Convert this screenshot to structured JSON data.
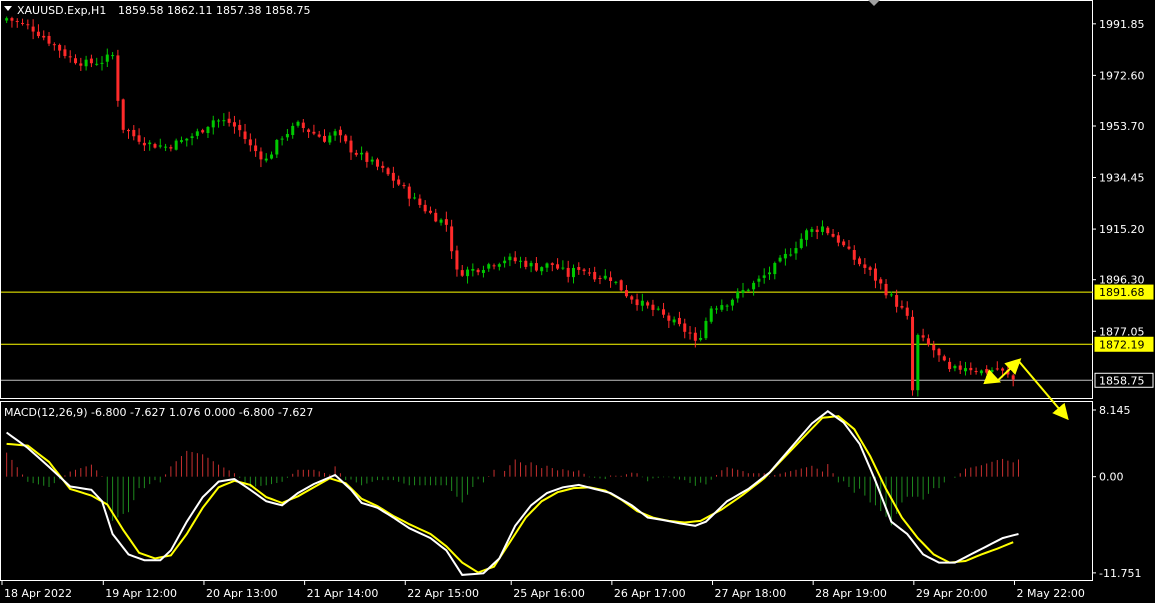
{
  "header": {
    "symbol": "XAUUSD.Exp,H1",
    "ohlc": "1859.58 1862.11 1857.38 1858.75"
  },
  "macd_header": {
    "label": "MACD(12,26,9) -6.800 -7.627 1.076 0.000 -6.800 -7.627"
  },
  "colors": {
    "background": "#000000",
    "bull": "#00c800",
    "bear": "#ff2a2a",
    "grid_frame": "#ffffff",
    "hline": "#ffff00",
    "macd_line": "#ffffff",
    "signal_line": "#ffff00",
    "arrow": "#ffff00"
  },
  "chart_data": [
    {
      "type": "candlestick",
      "symbol": "XAUUSD.Exp",
      "timeframe": "H1",
      "ylim": [
        1852.5,
        2000
      ],
      "y_ticks": [
        "1991.85",
        "1972.60",
        "1953.70",
        "1934.45",
        "1915.20",
        "1896.30",
        "1877.05"
      ],
      "x_ticks": [
        "18 Apr 2022",
        "19 Apr 12:00",
        "20 Apr 13:00",
        "21 Apr 14:00",
        "22 Apr 15:00",
        "25 Apr 16:00",
        "26 Apr 17:00",
        "27 Apr 18:00",
        "28 Apr 19:00",
        "29 Apr 20:00",
        "2 May 22:00"
      ],
      "horizontal_levels": [
        {
          "value": 1891.68,
          "label": "1891.68",
          "style": "tag-yellow"
        },
        {
          "value": 1872.19,
          "label": "1872.19",
          "style": "tag-yellow"
        },
        {
          "value": 1858.75,
          "label": "1858.75",
          "style": "tag-current"
        }
      ],
      "close_path": [
        [
          0,
          1994
        ],
        [
          5,
          1990
        ],
        [
          9,
          1984
        ],
        [
          12,
          1979
        ],
        [
          15,
          1977
        ],
        [
          18,
          1978
        ],
        [
          20,
          1980
        ],
        [
          21,
          1964
        ],
        [
          22,
          1953
        ],
        [
          24,
          1950
        ],
        [
          27,
          1947
        ],
        [
          30,
          1946
        ],
        [
          33,
          1948
        ],
        [
          36,
          1951
        ],
        [
          39,
          1956
        ],
        [
          42,
          1955
        ],
        [
          44,
          1952
        ],
        [
          46,
          1946
        ],
        [
          49,
          1941
        ],
        [
          52,
          1950
        ],
        [
          55,
          1954
        ],
        [
          57,
          1952
        ],
        [
          60,
          1949
        ],
        [
          62,
          1951
        ],
        [
          65,
          1945
        ],
        [
          68,
          1941
        ],
        [
          71,
          1937
        ],
        [
          74,
          1932
        ],
        [
          77,
          1926
        ],
        [
          80,
          1921
        ],
        [
          83,
          1917
        ],
        [
          85,
          1899
        ],
        [
          88,
          1900
        ],
        [
          91,
          1902
        ],
        [
          94,
          1904
        ],
        [
          97,
          1903
        ],
        [
          100,
          1901
        ],
        [
          103,
          1902
        ],
        [
          106,
          1898
        ],
        [
          108,
          1901
        ],
        [
          111,
          1898
        ],
        [
          114,
          1897
        ],
        [
          117,
          1891
        ],
        [
          120,
          1887
        ],
        [
          123,
          1884
        ],
        [
          126,
          1880
        ],
        [
          129,
          1876
        ],
        [
          131,
          1876
        ],
        [
          133,
          1886
        ],
        [
          136,
          1888
        ],
        [
          139,
          1892
        ],
        [
          142,
          1896
        ],
        [
          145,
          1901
        ],
        [
          148,
          1907
        ],
        [
          151,
          1914
        ],
        [
          154,
          1916
        ],
        [
          157,
          1911
        ],
        [
          160,
          1904
        ],
        [
          163,
          1899
        ],
        [
          166,
          1892
        ],
        [
          169,
          1885
        ],
        [
          172,
          1875
        ],
        [
          175,
          1870
        ],
        [
          178,
          1862
        ],
        [
          181,
          1864
        ],
        [
          184,
          1862
        ],
        [
          187,
          1863
        ],
        [
          190,
          1859
        ]
      ],
      "highlight_candles": [
        {
          "index": 130,
          "close": 1873.5,
          "low": 1871.0
        },
        {
          "index": 171,
          "close": 1855.0,
          "low": 1853.0
        }
      ],
      "annotations": [
        {
          "type": "arrow",
          "from": [
            185,
            1860
          ],
          "to": [
            187,
            1858.5
          ]
        },
        {
          "type": "arrow",
          "from": [
            187,
            1858.5
          ],
          "to": [
            191,
            1866
          ]
        },
        {
          "type": "arrow",
          "from": [
            191,
            1866
          ],
          "to": [
            200,
            1845
          ]
        }
      ]
    },
    {
      "type": "macd",
      "params": "MACD(12,26,9)",
      "values": {
        "main": -6.8,
        "signal": -7.627,
        "histogram": 1.076,
        "zero": 0.0
      },
      "ylim": [
        -12.5,
        9.0
      ],
      "y_ticks": [
        "8.145",
        "0.00",
        "-11.751"
      ],
      "macd_points": [
        [
          0,
          5.4
        ],
        [
          4,
          3.5
        ],
        [
          8,
          1.2
        ],
        [
          12,
          -1.2
        ],
        [
          16,
          -1.6
        ],
        [
          18,
          -3.0
        ],
        [
          20,
          -7.0
        ],
        [
          23,
          -9.5
        ],
        [
          26,
          -10.2
        ],
        [
          29,
          -10.2
        ],
        [
          31,
          -9.0
        ],
        [
          34,
          -5.5
        ],
        [
          37,
          -2.5
        ],
        [
          40,
          -0.6
        ],
        [
          43,
          -0.3
        ],
        [
          46,
          -1.6
        ],
        [
          49,
          -3.0
        ],
        [
          52,
          -3.5
        ],
        [
          55,
          -2.0
        ],
        [
          58,
          -0.9
        ],
        [
          62,
          0.2
        ],
        [
          65,
          -1.6
        ],
        [
          67,
          -3.2
        ],
        [
          70,
          -3.8
        ],
        [
          73,
          -5.0
        ],
        [
          76,
          -6.3
        ],
        [
          80,
          -7.5
        ],
        [
          83,
          -9.0
        ],
        [
          86,
          -12.0
        ],
        [
          90,
          -11.8
        ],
        [
          93,
          -10.0
        ],
        [
          96,
          -6.0
        ],
        [
          99,
          -3.5
        ],
        [
          102,
          -2.0
        ],
        [
          105,
          -1.3
        ],
        [
          108,
          -1.0
        ],
        [
          111,
          -1.5
        ],
        [
          114,
          -2.0
        ],
        [
          118,
          -3.5
        ],
        [
          121,
          -5.0
        ],
        [
          124,
          -5.3
        ],
        [
          127,
          -5.7
        ],
        [
          130,
          -6.0
        ],
        [
          132,
          -5.5
        ],
        [
          136,
          -3.0
        ],
        [
          140,
          -1.5
        ],
        [
          144,
          0.5
        ],
        [
          148,
          3.5
        ],
        [
          152,
          6.5
        ],
        [
          155,
          8.0
        ],
        [
          158,
          6.6
        ],
        [
          161,
          4.0
        ],
        [
          164,
          -0.5
        ],
        [
          167,
          -5.5
        ],
        [
          170,
          -7.0
        ],
        [
          173,
          -9.5
        ],
        [
          176,
          -10.5
        ],
        [
          179,
          -10.5
        ],
        [
          182,
          -9.5
        ],
        [
          185,
          -8.5
        ],
        [
          188,
          -7.5
        ],
        [
          191,
          -7.0
        ]
      ],
      "signal_points": [
        [
          0,
          4.0
        ],
        [
          4,
          3.8
        ],
        [
          8,
          1.8
        ],
        [
          12,
          -1.5
        ],
        [
          16,
          -2.3
        ],
        [
          19,
          -3.4
        ],
        [
          22,
          -6.5
        ],
        [
          25,
          -9.3
        ],
        [
          28,
          -10.0
        ],
        [
          31,
          -9.6
        ],
        [
          34,
          -7.0
        ],
        [
          37,
          -3.8
        ],
        [
          40,
          -1.3
        ],
        [
          43,
          -0.5
        ],
        [
          46,
          -1.0
        ],
        [
          49,
          -2.5
        ],
        [
          52,
          -3.2
        ],
        [
          55,
          -2.4
        ],
        [
          58,
          -1.3
        ],
        [
          61,
          -0.2
        ],
        [
          64,
          -0.8
        ],
        [
          67,
          -2.7
        ],
        [
          70,
          -3.6
        ],
        [
          73,
          -4.8
        ],
        [
          76,
          -5.8
        ],
        [
          80,
          -7.0
        ],
        [
          83,
          -8.5
        ],
        [
          86,
          -10.5
        ],
        [
          89,
          -11.7
        ],
        [
          92,
          -11.0
        ],
        [
          95,
          -8.0
        ],
        [
          98,
          -5.0
        ],
        [
          101,
          -3.0
        ],
        [
          104,
          -1.9
        ],
        [
          107,
          -1.4
        ],
        [
          110,
          -1.3
        ],
        [
          113,
          -1.7
        ],
        [
          116,
          -2.8
        ],
        [
          119,
          -4.2
        ],
        [
          122,
          -5.0
        ],
        [
          125,
          -5.4
        ],
        [
          128,
          -5.6
        ],
        [
          131,
          -5.4
        ],
        [
          135,
          -4.0
        ],
        [
          139,
          -2.2
        ],
        [
          143,
          -0.2
        ],
        [
          147,
          2.5
        ],
        [
          151,
          5.2
        ],
        [
          154,
          7.2
        ],
        [
          157,
          7.4
        ],
        [
          160,
          5.8
        ],
        [
          163,
          2.5
        ],
        [
          166,
          -1.5
        ],
        [
          169,
          -5.0
        ],
        [
          172,
          -7.5
        ],
        [
          175,
          -9.5
        ],
        [
          178,
          -10.5
        ],
        [
          181,
          -10.3
        ],
        [
          184,
          -9.5
        ],
        [
          187,
          -8.8
        ],
        [
          190,
          -8.0
        ]
      ]
    }
  ]
}
